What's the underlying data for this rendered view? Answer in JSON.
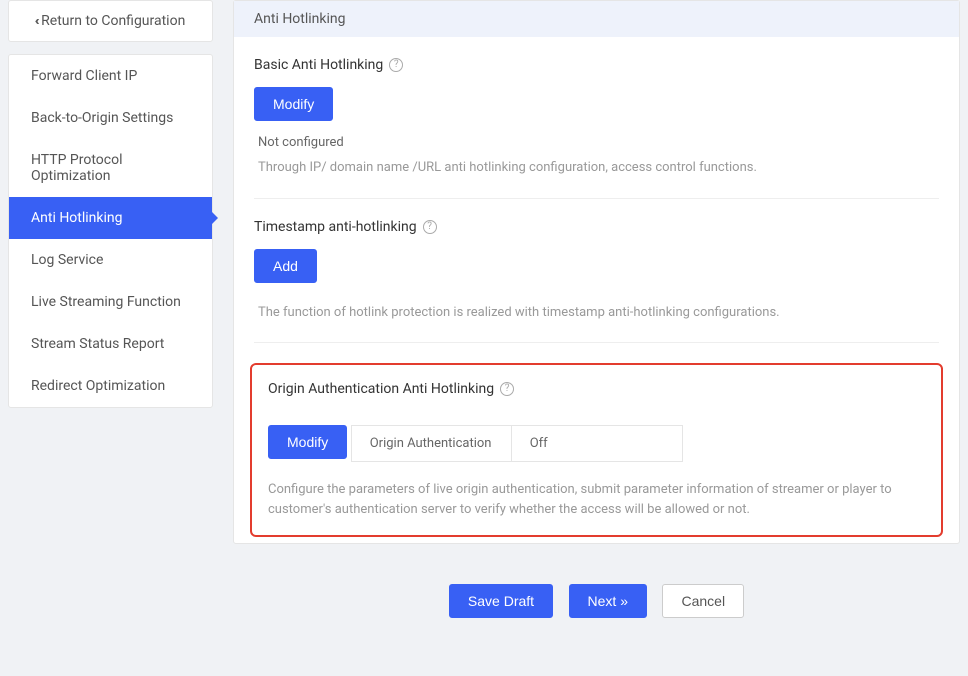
{
  "sidebar": {
    "return_label": "Return to Configuration",
    "items": [
      {
        "label": "Forward Client IP",
        "active": false
      },
      {
        "label": "Back-to-Origin Settings",
        "active": false
      },
      {
        "label": "HTTP Protocol Optimization",
        "active": false
      },
      {
        "label": "Anti Hotlinking",
        "active": true
      },
      {
        "label": "Log Service",
        "active": false
      },
      {
        "label": "Live Streaming Function",
        "active": false
      },
      {
        "label": "Stream Status Report",
        "active": false
      },
      {
        "label": "Redirect Optimization",
        "active": false
      }
    ]
  },
  "main": {
    "header": "Anti Hotlinking",
    "basic": {
      "title": "Basic Anti Hotlinking",
      "button": "Modify",
      "status": "Not configured",
      "desc": "Through IP/ domain name /URL anti hotlinking configuration, access control functions."
    },
    "timestamp": {
      "title": "Timestamp anti-hotlinking",
      "button": "Add",
      "desc": "The function of hotlink protection is realized with timestamp anti-hotlinking configurations."
    },
    "origin": {
      "title": "Origin Authentication Anti Hotlinking",
      "button": "Modify",
      "table_label": "Origin Authentication",
      "table_value": "Off",
      "desc": "Configure the parameters of live origin authentication, submit parameter information of streamer or player to customer's authentication server to verify whether the access will be allowed or not."
    }
  },
  "footer": {
    "save": "Save Draft",
    "next": "Next »",
    "cancel": "Cancel"
  }
}
